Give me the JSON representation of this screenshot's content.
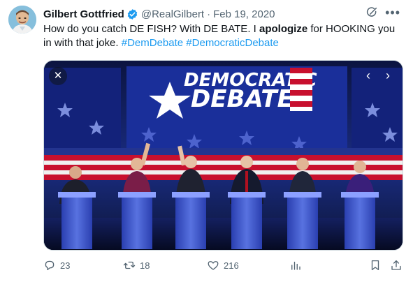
{
  "tweet": {
    "name": "Gilbert Gottfried",
    "handle": "@RealGilbert",
    "separator": "·",
    "date": "Feb 19, 2020",
    "text_parts": [
      {
        "t": "How do you catch DE FISH?  With DE BATE.  I ",
        "style": "normal"
      },
      {
        "t": "apologize",
        "style": "bold"
      },
      {
        "t": " for HOOKING you in with that joke. ",
        "style": "normal"
      },
      {
        "t": "#DemDebate",
        "style": "hashtag"
      },
      {
        "t": " ",
        "style": "normal"
      },
      {
        "t": "#DemocraticDebate",
        "style": "hashtag"
      }
    ],
    "colors": {
      "link": "#1d9bf0",
      "muted": "#536471",
      "verified": "#1d9bf0"
    }
  },
  "media": {
    "sign_line1": "DEMOCRATIC",
    "sign_line2": "DEBATE",
    "close_glyph": "✕",
    "prev_glyph": "‹",
    "next_glyph": "›",
    "colors": {
      "stage_blue": "#1c2f86",
      "stripe_red": "#c8102e",
      "podium": "#3b55c9"
    }
  },
  "actions": {
    "replies": "23",
    "retweets": "18",
    "likes": "216"
  },
  "icons": [
    "verified-badge-icon",
    "grok-icon",
    "more-icon",
    "close-icon",
    "reply-icon",
    "retweet-icon",
    "like-icon",
    "views-icon",
    "bookmark-icon",
    "share-icon"
  ]
}
